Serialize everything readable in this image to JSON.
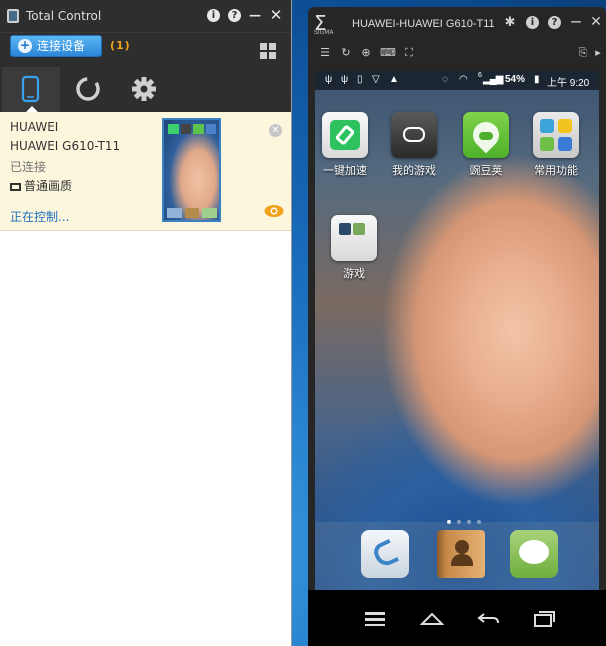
{
  "total_control": {
    "title": "Total Control",
    "connect_button": "连接设备",
    "device_count": "(1)",
    "device": {
      "brand": "HUAWEI",
      "model": "HUAWEI G610-T11",
      "status": "已连接",
      "quality": "普通画质",
      "controlling": "正在控制..."
    }
  },
  "sigma": {
    "title": "HUAWEI-HUAWEI G610-T11",
    "logo_text": "SIGMA",
    "status_bar": {
      "battery": "54%",
      "time": "上午 9:20",
      "signal_badge": "6"
    },
    "apps": [
      {
        "label": "一键加速"
      },
      {
        "label": "我的游戏"
      },
      {
        "label": "豌豆荚"
      },
      {
        "label": "常用功能"
      },
      {
        "label": "游戏"
      }
    ]
  }
}
